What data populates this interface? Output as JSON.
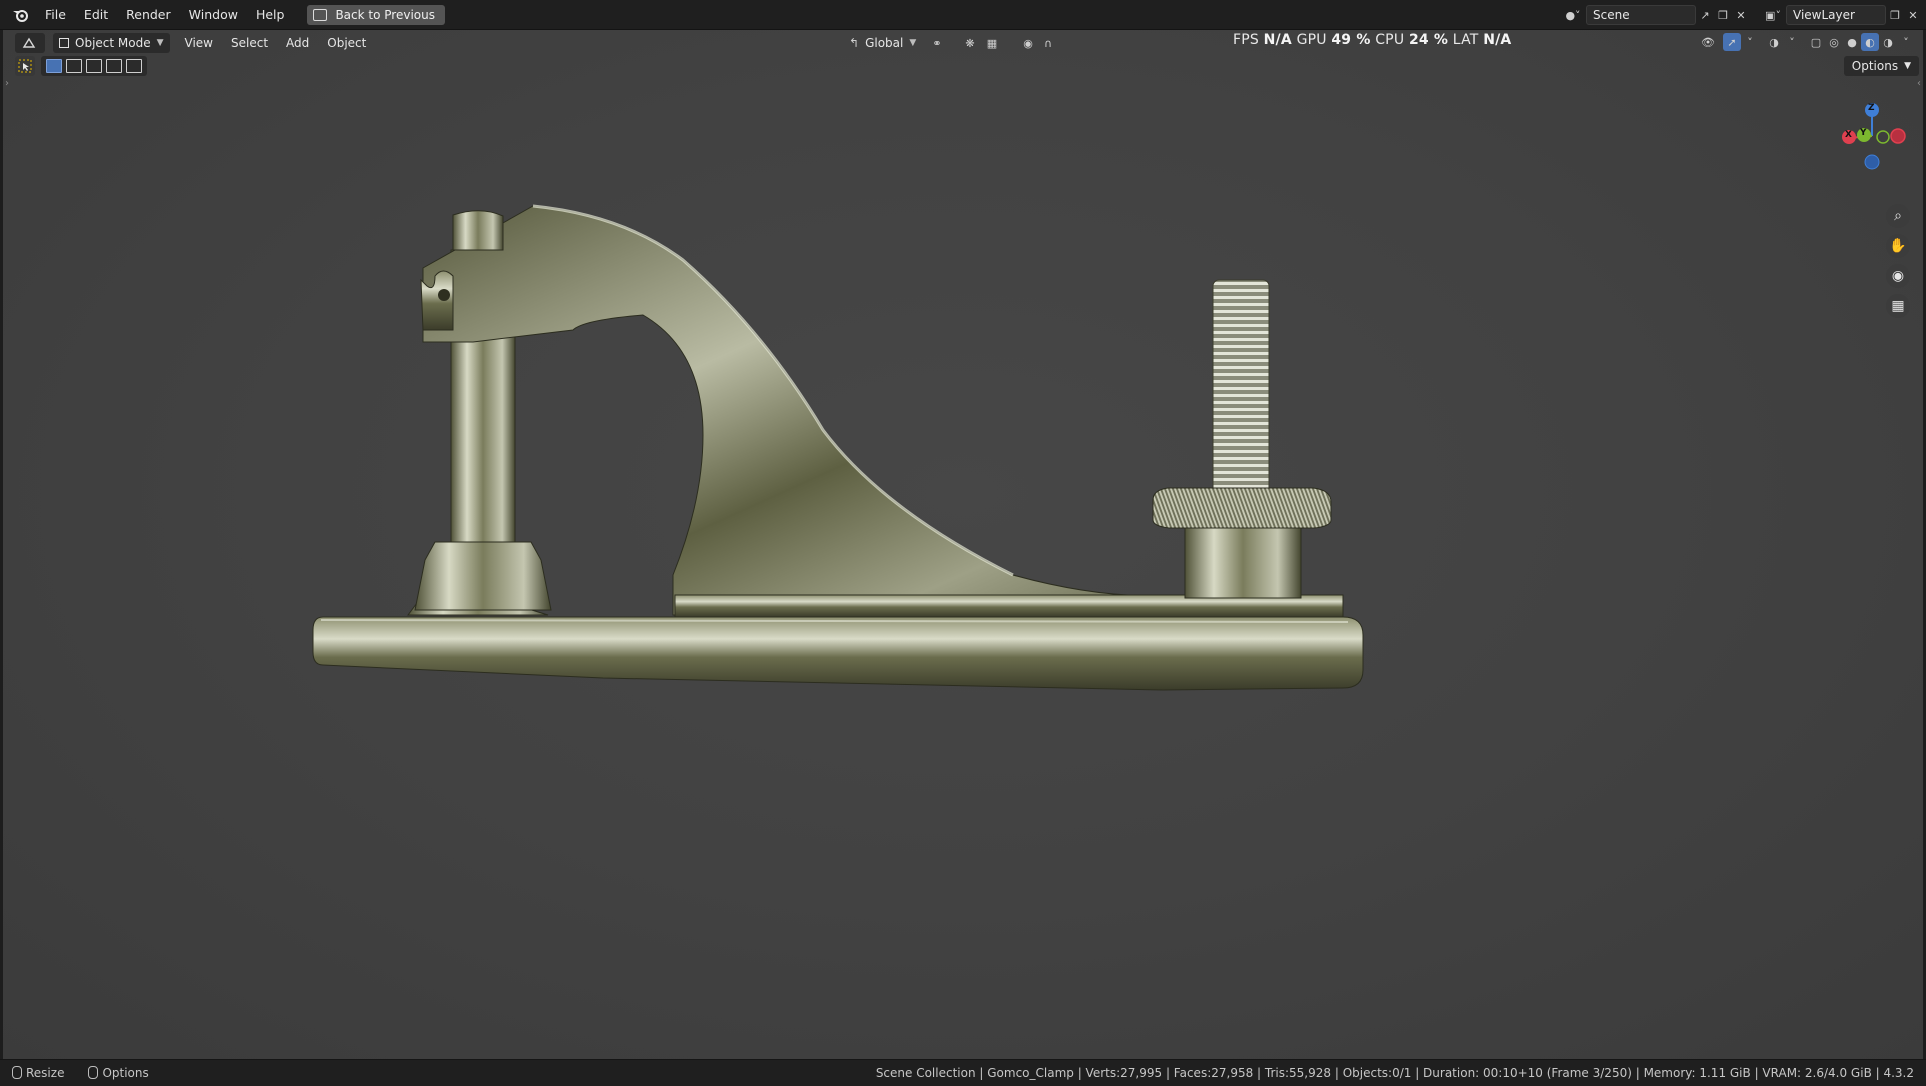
{
  "menu": [
    "File",
    "Edit",
    "Render",
    "Window",
    "Help"
  ],
  "back_button": "Back to Previous",
  "scene_name": "Scene",
  "view_layer": "ViewLayer",
  "viewport_header": {
    "mode": "Object Mode",
    "menus": [
      "View",
      "Select",
      "Add",
      "Object"
    ],
    "orientation": "Global",
    "options": "Options"
  },
  "stats": {
    "fps_label": "FPS",
    "fps": "N/A",
    "gpu_label": "GPU",
    "gpu": "49 %",
    "cpu_label": "CPU",
    "cpu": "24 %",
    "lat_label": "LAT",
    "lat": "N/A"
  },
  "gizmo": {
    "z": "Z",
    "y": "Y",
    "x": "X"
  },
  "statusbar": {
    "resize": "Resize",
    "options": "Options",
    "info": "Scene Collection | Gomco_Clamp | Verts:27,995 | Faces:27,958 | Tris:55,928 | Objects:0/1 | Duration: 00:10+10 (Frame 3/250) | Memory: 1.11 GiB | VRAM: 2.6/4.0 GiB | 4.3.2"
  },
  "colors": {
    "accent": "#4772b3",
    "x_axis": "#e0404f",
    "y_axis": "#7cb82f",
    "z_axis": "#3f7fd8"
  }
}
